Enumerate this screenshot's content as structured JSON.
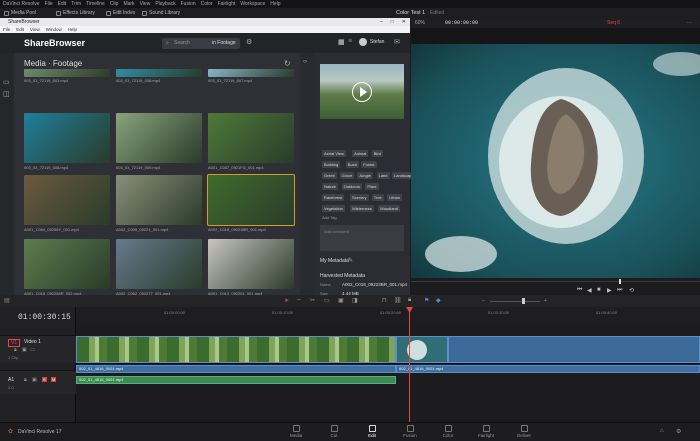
{
  "menubar": {
    "items": [
      "DaVinci Resolve",
      "File",
      "Edit",
      "Trim",
      "Timeline",
      "Clip",
      "Mark",
      "View",
      "Playback",
      "Fusion",
      "Color",
      "Fairlight",
      "Workspace",
      "Help"
    ]
  },
  "toolbar": {
    "media_pool": "Media Pool",
    "effects_library": "Effects Library",
    "edit_index": "Edit Index",
    "sound_library": "Sound Library",
    "project_title": "Color Test 1",
    "project_state": "Edited",
    "zoom": "60%",
    "timecode": "00:00:00:00",
    "sequence": "Seq 6"
  },
  "sharebrowser": {
    "window_title": "ShareBrowser",
    "menu": [
      "File",
      "Edit",
      "View",
      "Window",
      "Help"
    ],
    "logo": "ShareBrowser",
    "search_placeholder": "Search",
    "search_scope": "in Footage",
    "user": "Stefan",
    "breadcrumb": "Media · Footage",
    "item_count": "100 items",
    "rows": [
      [
        "003_03_72119_003.mp4",
        "003_03_72119_006.mp4",
        "003_03_72119_007.mp4"
      ],
      [
        "003_03_72119_008.mp4",
        "003_03_72119_009.mp4",
        "A001_C037_0921FG_001.mp4"
      ],
      [
        "A001_C064_09256Y_001.mp4",
        "A002_C009_09221_001.mp4",
        "A002_C018_09223BR_001.mp4"
      ],
      [
        "A001_C018_092258R_002.mp4",
        "A002_C062_092277_001.mp4",
        "A001_C013_092201_001.mp4"
      ]
    ],
    "tags": [
      "Aerial View",
      "Animal",
      "Bird",
      "Building",
      "Bush",
      "Forest",
      "Green",
      "Grove",
      "Jungle",
      "Land",
      "Landscape",
      "Nature",
      "Outdoors",
      "Plant",
      "Rainforest",
      "Scenery",
      "Tree",
      "Urban",
      "Vegetation",
      "Wilderness",
      "Woodland"
    ],
    "add_tag": "Add Tag",
    "add_comment": "Add comment",
    "my_metadata": "My Metadata",
    "harvested": "Harvested Metadata",
    "meta": [
      {
        "k": "Name",
        "v": "A002_C018_09223BR_001.mp4"
      },
      {
        "k": "Size",
        "v": "4.44 MB"
      },
      {
        "k": "Duration",
        "v": "00:00:07.09"
      }
    ]
  },
  "timeline": {
    "timecode": "01:00:30:15",
    "ruler": [
      "01:00:00:00",
      "01:00:10:00",
      "01:00:20:00",
      "01:00:30:00",
      "01:00:40:00",
      "01:00:50:00"
    ],
    "video_track": {
      "label": "Video 1",
      "id": "V1",
      "clips": "1 Clip"
    },
    "audio_track": {
      "id": "A1",
      "channels": "2.0"
    },
    "clip_a1": "002_01_4818_0001.mp4",
    "clip_a2": "002_01_4818_0001.mp4",
    "clip_v2": "002_01_4818_0001.mp4"
  },
  "pages": {
    "app": "DaVinci Resolve 17",
    "items": [
      "Media",
      "Cut",
      "Edit",
      "Fusion",
      "Color",
      "Fairlight",
      "Deliver"
    ],
    "active": "Edit"
  }
}
